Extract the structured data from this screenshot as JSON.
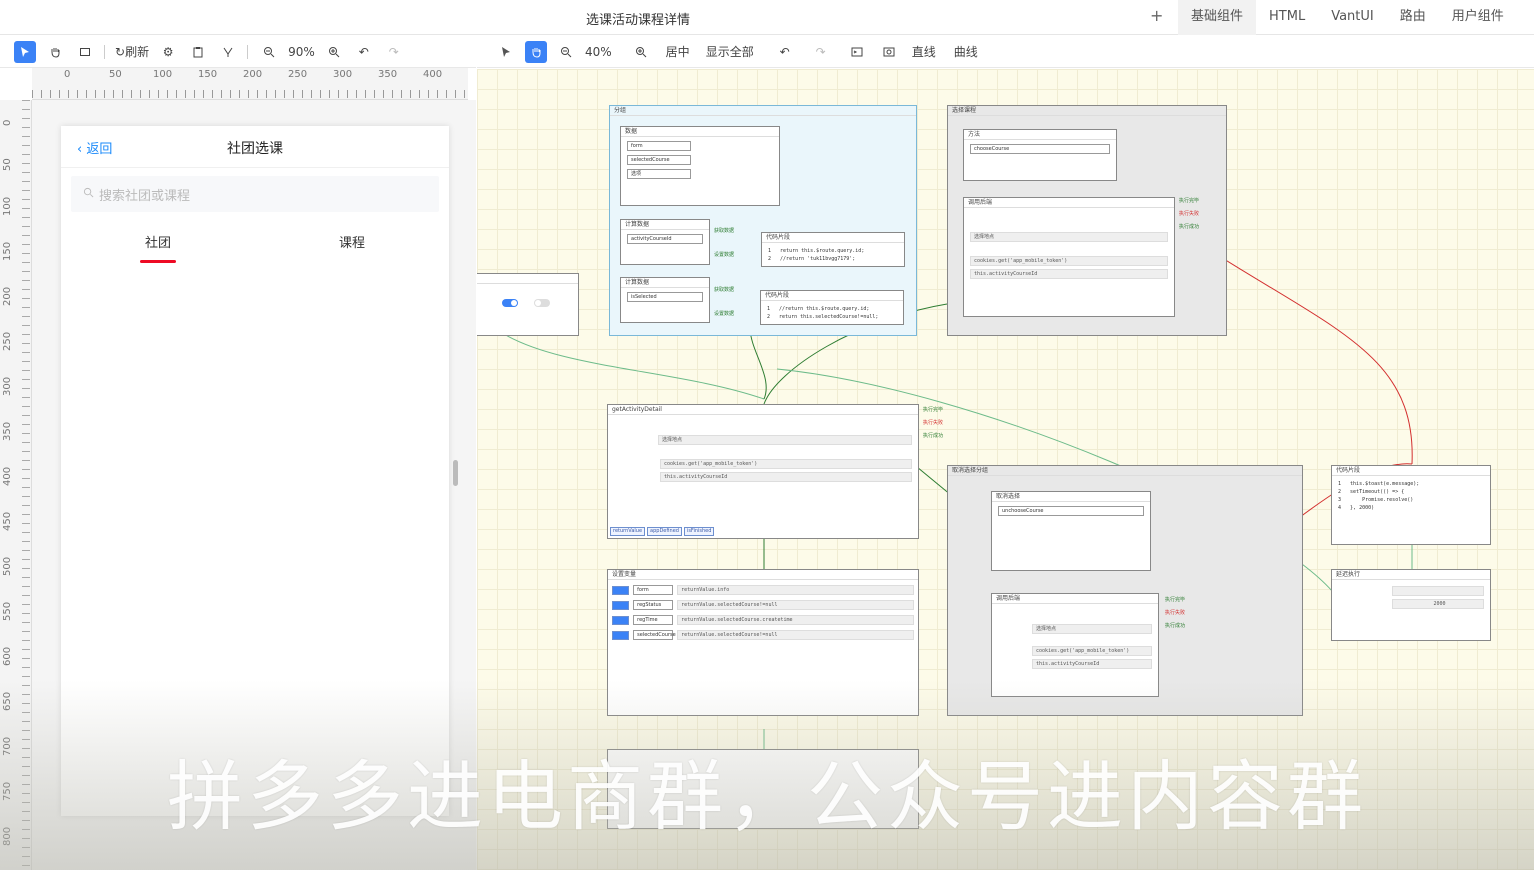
{
  "window": {
    "title": "选课活动课程详情",
    "add_label": "+",
    "tabs": [
      "基础组件",
      "HTML",
      "VantUI",
      "路由",
      "用户组件"
    ]
  },
  "left_toolbar": {
    "refresh_label": "刷新",
    "zoom": "90%"
  },
  "right_toolbar": {
    "zoom": "40%",
    "center_label": "居中",
    "show_all_label": "显示全部",
    "line_label": "直线",
    "curve_label": "曲线"
  },
  "ruler": {
    "top_ticks": [
      "0",
      "50",
      "100",
      "150",
      "200",
      "250",
      "300",
      "350",
      "400"
    ],
    "left_ticks": [
      "0",
      "50",
      "100",
      "150",
      "200",
      "250",
      "300",
      "350",
      "400",
      "450",
      "500",
      "550",
      "600",
      "650",
      "700",
      "750",
      "800"
    ]
  },
  "phone": {
    "back_label": "返回",
    "title": "社团选课",
    "search_placeholder": "搜索社团或课程",
    "tabs": [
      "社团",
      "课程"
    ]
  },
  "nodes": {
    "group_blue_title": "分组",
    "data_title": "数据",
    "data_fields": [
      "form",
      "selectedCourse",
      "选项"
    ],
    "computed1_title": "计算数据",
    "computed1_field": "activityCourseId",
    "computed2_title": "计算数据",
    "computed2_field": "isSelected",
    "code1_title": "代码片段",
    "code1_lines": "1   return this.$route.query.id;\n2   //return 'tuk11bvgg7179';",
    "code2_title": "代码片段",
    "code2_lines": "1   //return this.$route.query.id;\n2   return this.selectedCourse!=null;",
    "get_label": "获取数据",
    "set_label": "设置数据",
    "get_activity_title": "getActivityDetail",
    "async_label": "选择地点",
    "cookie_code": "cookies.get('app_mobile_token')",
    "activity_code": "this.activityCourseId",
    "tags_main": [
      "returnValue",
      "appDefined",
      "isFinished"
    ],
    "set_vars_title": "设置变量",
    "set_vars": [
      "form",
      "regStatus",
      "regTime",
      "selectedCourse"
    ],
    "set_vars_code": [
      "returnValue.info",
      "returnValue.selectedCourse!=null",
      "returnValue.selectedCourse.createtime",
      "returnValue.selectedCourse!=null"
    ],
    "select_group_title": "选择课程",
    "method_title": "方法",
    "method_field": "chooseCourse",
    "call_async_title": "调用后端",
    "unselect_group_title": "取消选择分组",
    "unselect_title": "取消选择",
    "unselect_field": "unchooseCourse",
    "toast_title": "代码片段",
    "toast_lines": "1   this.$toast(e.message);\n2   setTimeout(() => {\n3       Promise.resolve()\n4   }, 2000)",
    "delay_title": "延迟执行",
    "delay_value": "2000",
    "ports": [
      "执行完毕",
      "执行失败",
      "执行成功"
    ]
  },
  "overlay": {
    "caption": "拼多多进电商群，公众号进内容群"
  }
}
